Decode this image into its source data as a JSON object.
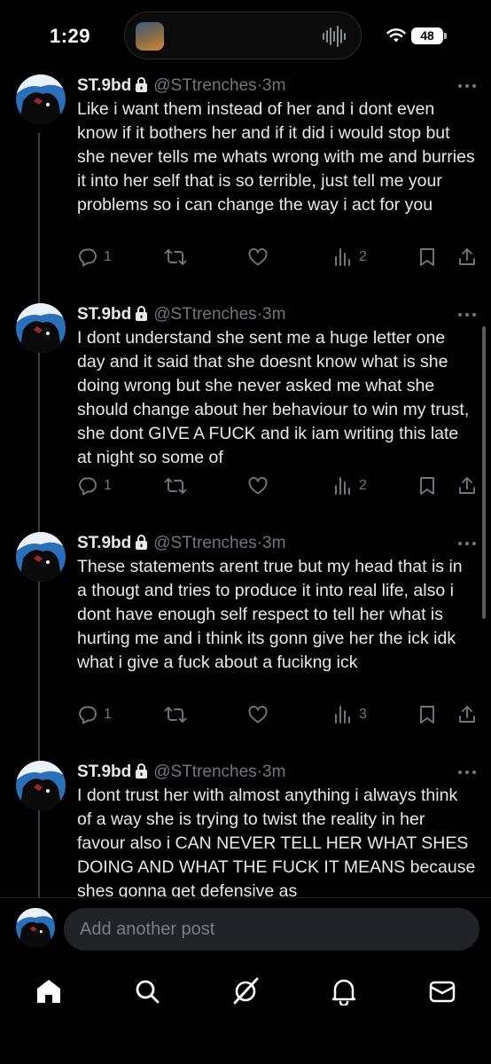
{
  "status": {
    "time": "1:29",
    "battery": "48"
  },
  "posts": [
    {
      "display_name": "ST.9bd",
      "handle": "@STtrenches",
      "separator": "·",
      "ago": "3m",
      "text": "Like i want them instead of her and i dont even know if it bothers her and if it did i would stop but she never tells me whats wrong with me and burries it into her self that is so terrible, just tell me your problems so i can change the way i act for you",
      "replies": "1",
      "reposts": "",
      "likes": "",
      "views": "2"
    },
    {
      "display_name": "ST.9bd",
      "handle": "@STtrenches",
      "separator": "·",
      "ago": "3m",
      "text": "I dont understand she sent me a huge letter one day and it said that she doesnt know what is she doing wrong but she never asked me what she should change about her behaviour to win my trust, she dont GIVE A FUCK and ik iam writing this late at night so some of",
      "replies": "1",
      "reposts": "",
      "likes": "",
      "views": "2"
    },
    {
      "display_name": "ST.9bd",
      "handle": "@STtrenches",
      "separator": "·",
      "ago": "3m",
      "text": "These statements arent true but my head that is in a thougt and tries to produce it into real life, also i dont have enough self respect to tell her what is hurting me and i think its gonn give her the ick idk what i give a fuck about a fucikng ick",
      "replies": "1",
      "reposts": "",
      "likes": "",
      "views": "3"
    },
    {
      "display_name": "ST.9bd",
      "handle": "@STtrenches",
      "separator": "·",
      "ago": "3m",
      "text": "I dont trust her with almost anything i always think of a way she is trying to twist the reality in her favour also i CAN NEVER TELL HER WHAT SHES DOING AND WHAT THE FUCK IT MEANS because shes gonna get defensive as",
      "replies": "",
      "reposts": "",
      "likes": "",
      "views": ""
    }
  ],
  "compose": {
    "placeholder": "Add another post"
  },
  "icons": {
    "status": [
      "now-playing-thumbnail-icon",
      "audio-waveform-icon",
      "wifi-icon",
      "battery-icon"
    ],
    "post": [
      "lock-icon",
      "more-icon",
      "reply-icon",
      "repost-icon",
      "like-icon",
      "views-icon",
      "bookmark-icon",
      "share-icon"
    ],
    "nav": [
      "home-icon",
      "search-icon",
      "grok-icon",
      "notifications-icon",
      "messages-icon"
    ]
  },
  "colors": {
    "background": "#000000",
    "text": "#e7e9ea",
    "muted": "#71767b",
    "thread_line": "#3a3f45",
    "input_bg": "#1f2226"
  }
}
